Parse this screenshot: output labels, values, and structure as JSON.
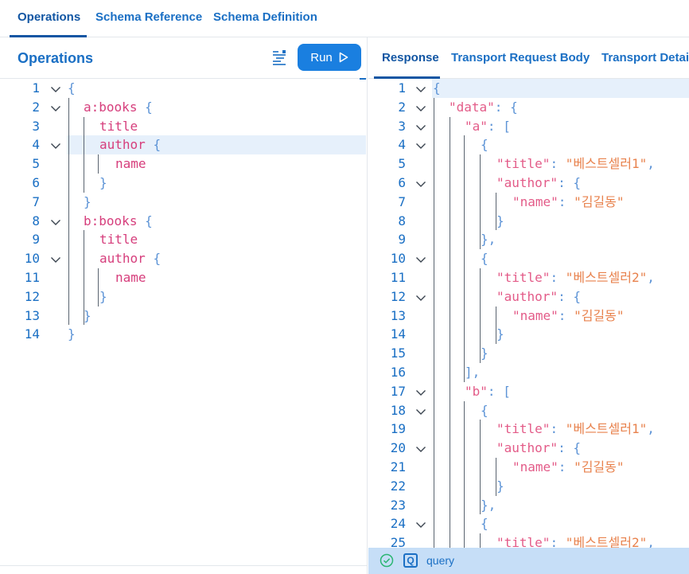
{
  "top_tabs": {
    "operations": "Operations",
    "schema_reference": "Schema Reference",
    "schema_definition": "Schema Definition"
  },
  "left": {
    "title": "Operations",
    "run_label": "Run",
    "prettify_icon": "prettify-icon",
    "run_icon": "play-icon",
    "lines": [
      {
        "n": "1",
        "text": "{"
      },
      {
        "n": "2",
        "text": "a:books {"
      },
      {
        "n": "3",
        "text": "title"
      },
      {
        "n": "4",
        "text": "author {"
      },
      {
        "n": "5",
        "text": "name"
      },
      {
        "n": "6",
        "text": "}"
      },
      {
        "n": "7",
        "text": "}"
      },
      {
        "n": "8",
        "text": "b:books {"
      },
      {
        "n": "9",
        "text": "title"
      },
      {
        "n": "10",
        "text": "author {"
      },
      {
        "n": "11",
        "text": "name"
      },
      {
        "n": "12",
        "text": "}"
      },
      {
        "n": "13",
        "text": "}"
      },
      {
        "n": "14",
        "text": "}"
      }
    ]
  },
  "right": {
    "tabs": {
      "response": "Response",
      "transport_request_body": "Transport Request Body",
      "transport_details": "Transport Detai"
    },
    "lines": [
      {
        "n": "1",
        "text": "{"
      },
      {
        "n": "2",
        "text": "\"data\": {"
      },
      {
        "n": "3",
        "text": "\"a\": ["
      },
      {
        "n": "4",
        "text": "{"
      },
      {
        "n": "5",
        "text": "\"title\": \"베스트셀러1\","
      },
      {
        "n": "6",
        "text": "\"author\": {"
      },
      {
        "n": "7",
        "text": "\"name\": \"김길동\""
      },
      {
        "n": "8",
        "text": "}"
      },
      {
        "n": "9",
        "text": "},"
      },
      {
        "n": "10",
        "text": "{"
      },
      {
        "n": "11",
        "text": "\"title\": \"베스트셀러2\","
      },
      {
        "n": "12",
        "text": "\"author\": {"
      },
      {
        "n": "13",
        "text": "\"name\": \"김길동\""
      },
      {
        "n": "14",
        "text": "}"
      },
      {
        "n": "15",
        "text": "}"
      },
      {
        "n": "16",
        "text": "],"
      },
      {
        "n": "17",
        "text": "\"b\": ["
      },
      {
        "n": "18",
        "text": "{"
      },
      {
        "n": "19",
        "text": "\"title\": \"베스트셀러1\","
      },
      {
        "n": "20",
        "text": "\"author\": {"
      },
      {
        "n": "21",
        "text": "\"name\": \"김길동\""
      },
      {
        "n": "22",
        "text": "}"
      },
      {
        "n": "23",
        "text": "},"
      },
      {
        "n": "24",
        "text": "{"
      },
      {
        "n": "25",
        "text": "\"title\": \"베스트셀러2\","
      }
    ]
  },
  "status": {
    "check_icon": "check-circle-icon",
    "query_icon": "q-icon",
    "query_icon_letter": "Q",
    "label": "query"
  },
  "colors": {
    "accent": "#1a7fe0",
    "tab_text": "#1a6fc4",
    "field": "#d63e7c",
    "string": "#e8824d",
    "brace": "#5c93d6",
    "status_bar": "#c6def7",
    "line_highlight": "#e6f0fb"
  }
}
